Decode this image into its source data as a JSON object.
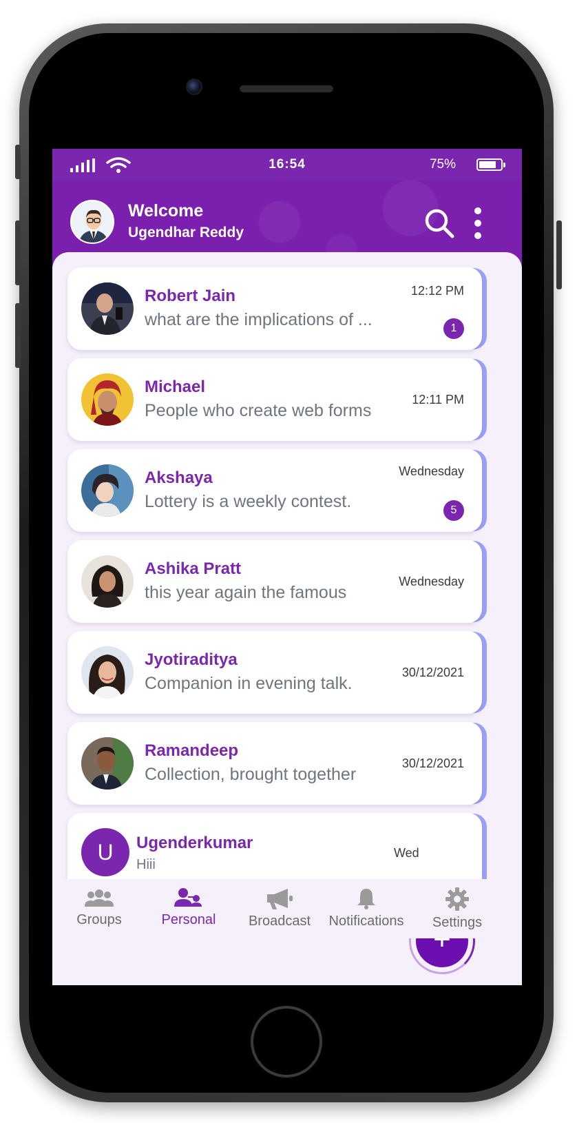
{
  "status_bar": {
    "time": "16:54",
    "battery": "75%"
  },
  "header": {
    "welcome": "Welcome",
    "user_name": "Ugendhar Reddy"
  },
  "chats": [
    {
      "name": "Robert Jain",
      "message": "what are the implications of ...",
      "time": "12:12 PM",
      "unread": "1"
    },
    {
      "name": "Michael",
      "message": "People who create web forms",
      "time": "12:11 PM",
      "unread": ""
    },
    {
      "name": "Akshaya",
      "message": "Lottery is a weekly contest.",
      "time": "Wednesday",
      "unread": "5"
    },
    {
      "name": "Ashika Pratt",
      "message": "this year again the famous",
      "time": "Wednesday",
      "unread": ""
    },
    {
      "name": "Jyotiraditya",
      "message": "Companion in evening talk.",
      "time": "30/12/2021",
      "unread": ""
    },
    {
      "name": "Ramandeep",
      "message": "Collection, brought together",
      "time": "30/12/2021",
      "unread": ""
    },
    {
      "name": "Ugenderkumar",
      "message": "Hiii",
      "time": "Wed",
      "initial": "U"
    }
  ],
  "fab": {
    "label": "+"
  },
  "bottom_nav": [
    {
      "label": "Groups",
      "icon": "groups-icon"
    },
    {
      "label": "Personal",
      "icon": "personal-icon",
      "active": true
    },
    {
      "label": "Broadcast",
      "icon": "megaphone-icon"
    },
    {
      "label": "Notifications",
      "icon": "bell-icon"
    },
    {
      "label": "Settings",
      "icon": "gear-icon"
    }
  ],
  "colors": {
    "primary": "#7a26ae",
    "accent_stripe": "#9aa2f7",
    "background": "#f6f0fa"
  }
}
